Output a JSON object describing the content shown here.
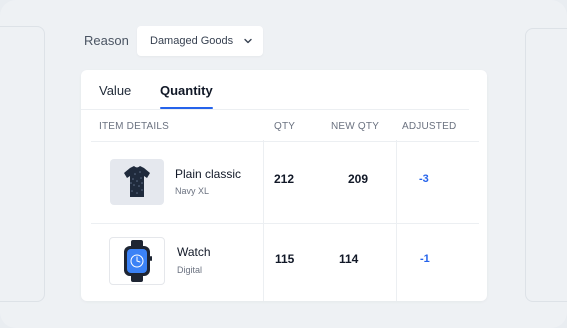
{
  "reason": {
    "label": "Reason",
    "selected": "Damaged Goods"
  },
  "tabs": [
    {
      "label": "Value",
      "active": false
    },
    {
      "label": "Quantity",
      "active": true
    }
  ],
  "table": {
    "headers": {
      "item": "ITEM DETAILS",
      "qty": "QTY",
      "new_qty": "NEW QTY",
      "adjusted": "ADJUSTED"
    },
    "rows": [
      {
        "name": "Plain classic",
        "variant": "Navy XL",
        "icon": "tshirt-icon",
        "qty": "212",
        "new_qty": "209",
        "adjusted": "-3"
      },
      {
        "name": "Watch",
        "variant": "Digital",
        "icon": "smartwatch-icon",
        "qty": "115",
        "new_qty": "114",
        "adjusted": "-1"
      }
    ]
  },
  "colors": {
    "accent": "#2563eb",
    "background": "#eef1f4",
    "card": "#ffffff"
  }
}
